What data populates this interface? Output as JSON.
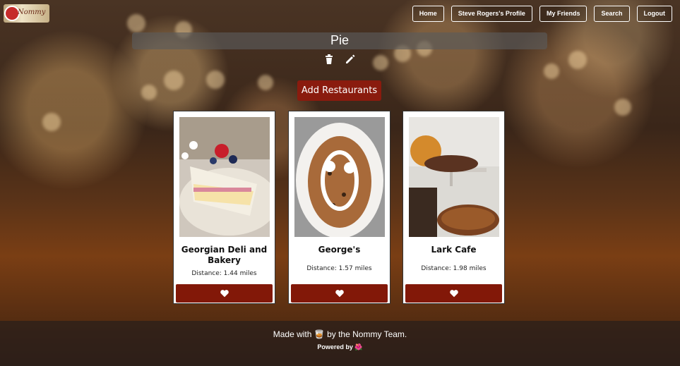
{
  "nav": {
    "home": "Home",
    "profile": "Steve Rogers's Profile",
    "friends": "My Friends",
    "search": "Search",
    "logout": "Logout"
  },
  "list_title": "Pie",
  "add_button": "Add Restaurants",
  "cards": [
    {
      "name": "Georgian Deli and Bakery",
      "distance": "Distance: 1.44 miles"
    },
    {
      "name": "George's",
      "distance": "Distance: 1.57 miles"
    },
    {
      "name": "Lark Cafe",
      "distance": "Distance: 1.98 miles"
    }
  ],
  "footer": {
    "made_with_pre": "Made with",
    "made_with_icon": "🥃",
    "made_with_post": "by the Nommy Team.",
    "powered_by": "Powered by",
    "powered_icon": "🌺"
  },
  "icons": {
    "delete": "trash-icon",
    "edit": "pencil-icon",
    "favorite": "heart-icon"
  },
  "colors": {
    "accent": "#821808",
    "add_button": "#8a1b0e"
  }
}
